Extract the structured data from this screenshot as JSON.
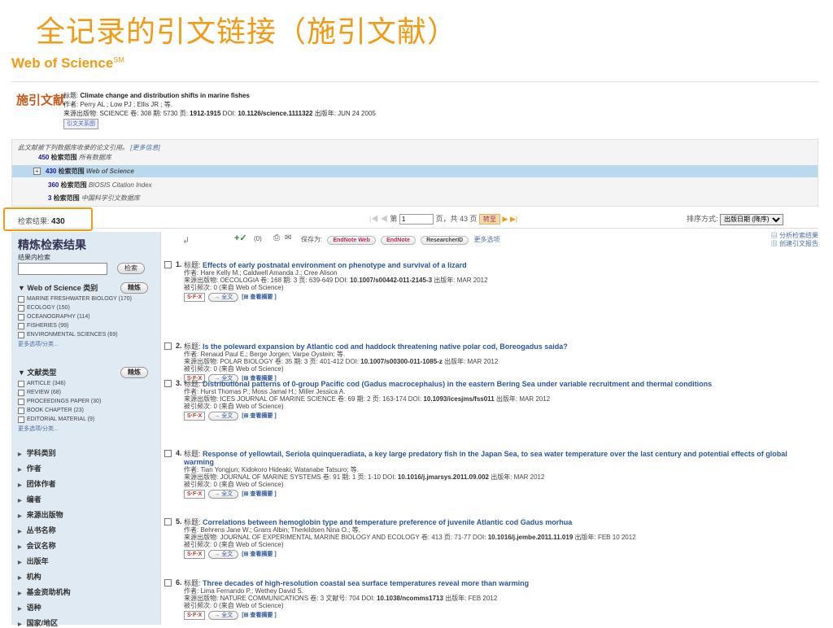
{
  "slide_title": "全记录的引文链接（施引文献）",
  "brand": {
    "name": "Web of Science",
    "mark": "SM"
  },
  "citing": {
    "heading": "施引文献",
    "title_label": "标题:",
    "title": "Climate change and distribution shifts in marine fishes",
    "authors": "作者: Perry AL ; Low PJ ; Ellis JR ; 等.",
    "source_prefix": "来源出版物: SCIENCE 卷: 308 期: 5730 页:",
    "pages": "1912-1915",
    "doi_label": "DOI:",
    "doi": "10.1126/science.1111322",
    "date": "出版年: JUN 24 2005",
    "map": "引文关系图"
  },
  "cited_by": {
    "note": "此文献被下列数据库收录的论文引用。",
    "more": "[更多信息]",
    "rows": [
      {
        "count": "450",
        "label": "检索范围",
        "db": "所有数据库"
      },
      {
        "count": "430",
        "label": "检索范围",
        "db": "Web of Science"
      },
      {
        "count": "360",
        "label": "检索范围",
        "db": "BIOSIS Citation Index"
      },
      {
        "count": "3",
        "label": "检索范围",
        "db": "中国科学引文数据库"
      }
    ]
  },
  "results_bar": {
    "hits_label": "检索结果:",
    "hits": "430",
    "page_prefix": "第",
    "page": "1",
    "page_suffix": "页，共 43 页",
    "go": "转至",
    "sort_label": "排序方式:",
    "sort_value": "出版日期 (降序)"
  },
  "sidebar": {
    "title": "精炼检索结果",
    "within_label": "结果内检索",
    "search_btn": "检索",
    "refine_btn": "精炼",
    "wos_heading": "Web of Science 类别",
    "wos_items": [
      "MARINE FRESHWATER BIOLOGY (170)",
      "ECOLOGY (150)",
      "OCEANOGRAPHY (114)",
      "FISHERIES (99)",
      "ENVIRONMENTAL SCIENCES (69)"
    ],
    "more": "更多选项/分类...",
    "doc_heading": "文献类型",
    "doc_items": [
      "ARTICLE (346)",
      "REVIEW (68)",
      "PROCEEDINGS PAPER (30)",
      "BOOK CHAPTER (23)",
      "EDITORIAL MATERIAL (9)"
    ],
    "facets": [
      "学科类别",
      "作者",
      "团体作者",
      "编者",
      "来源出版物",
      "丛书名称",
      "会议名称",
      "出版年",
      "机构",
      "基金资助机构",
      "语种",
      "国家/地区"
    ]
  },
  "toolbar": {
    "count": "(0)",
    "save_as": "保存为:",
    "endnote_web": "EndNote Web",
    "endnote": "EndNote",
    "researcherid": "ResearcherID",
    "more": "更多选项",
    "analyze": "分析检索结果",
    "report": "创建引文报告"
  },
  "labels": {
    "title": "标题:",
    "cited": "被引频次: 0 (来自 Web of Science)",
    "sfx": "S·F·X",
    "full": "全文",
    "abstract": "[⊞ 查看摘要 ]"
  },
  "records": [
    {
      "n": "1.",
      "title": "Effects of early postnatal environment on phenotype and survival of a lizard",
      "authors": "作者: Hare Kelly M.; Caldwell Amanda J.; Cree Alison",
      "source": "来源出版物: OECOLOGIA 卷: 168 期: 3 页: 639-649 DOI:",
      "doi": "10.1007/s00442-011-2145-3",
      "date": "出版年: MAR 2012"
    },
    {
      "n": "2.",
      "title": "Is the poleward expansion by Atlantic cod and haddock threatening native polar cod, Boreogadus saida?",
      "authors": "作者: Renaud Paul E.; Berge Jorgen; Varpe Oystein; 等.",
      "source": "来源出版物: POLAR BIOLOGY 卷: 35 期: 3 页: 401-412 DOI:",
      "doi": "10.1007/s00300-011-1085-z",
      "date": "出版年: MAR 2012"
    },
    {
      "n": "3.",
      "title": "Distributional patterns of 0-group Pacific cod (Gadus macrocephalus) in the eastern Bering Sea under variable recruitment and thermal conditions",
      "authors": "作者: Hurst Thomas P.; Moss Jamal H.; Miller Jessica A.",
      "source": "来源出版物: ICES JOURNAL OF MARINE SCIENCE 卷: 69 期: 2 页: 163-174 DOI:",
      "doi": "10.1093/icesjms/fss011",
      "date": "出版年: MAR 2012"
    },
    {
      "n": "4.",
      "title": "Response of yellowtail, Seriola quinqueradiata, a key large predatory fish in the Japan Sea, to sea water temperature over the last century and potential effects of global warming",
      "authors": "作者: Tian Yongjun; Kidokoro Hideaki; Watanabe Tatsuro; 等.",
      "source": "来源出版物: JOURNAL OF MARINE SYSTEMS 卷: 91 期: 1 页: 1-10 DOI:",
      "doi": "10.1016/j.jmarsys.2011.09.002",
      "date": "出版年: MAR 2012"
    },
    {
      "n": "5.",
      "title": "Correlations between hemoglobin type and temperature preference of juvenile Atlantic cod Gadus morhua",
      "authors": "作者: Behrens Jane W.; Grans Albin; Therkildsen Nina O.; 等.",
      "source": "来源出版物: JOURNAL OF EXPERIMENTAL MARINE BIOLOGY AND ECOLOGY 卷: 413 页: 71-77 DOI:",
      "doi": "10.1016/j.jembe.2011.11.019",
      "date": "出版年: FEB 10 2012"
    },
    {
      "n": "6.",
      "title": "Three decades of high-resolution coastal sea surface temperatures reveal more than warming",
      "authors": "作者: Lima Fernando P.; Wethey David S.",
      "source": "来源出版物: NATURE COMMUNICATIONS 卷: 3 文献号: 704 DOI:",
      "doi": "10.1038/ncomms1713",
      "date": "出版年: FEB 2012"
    }
  ]
}
